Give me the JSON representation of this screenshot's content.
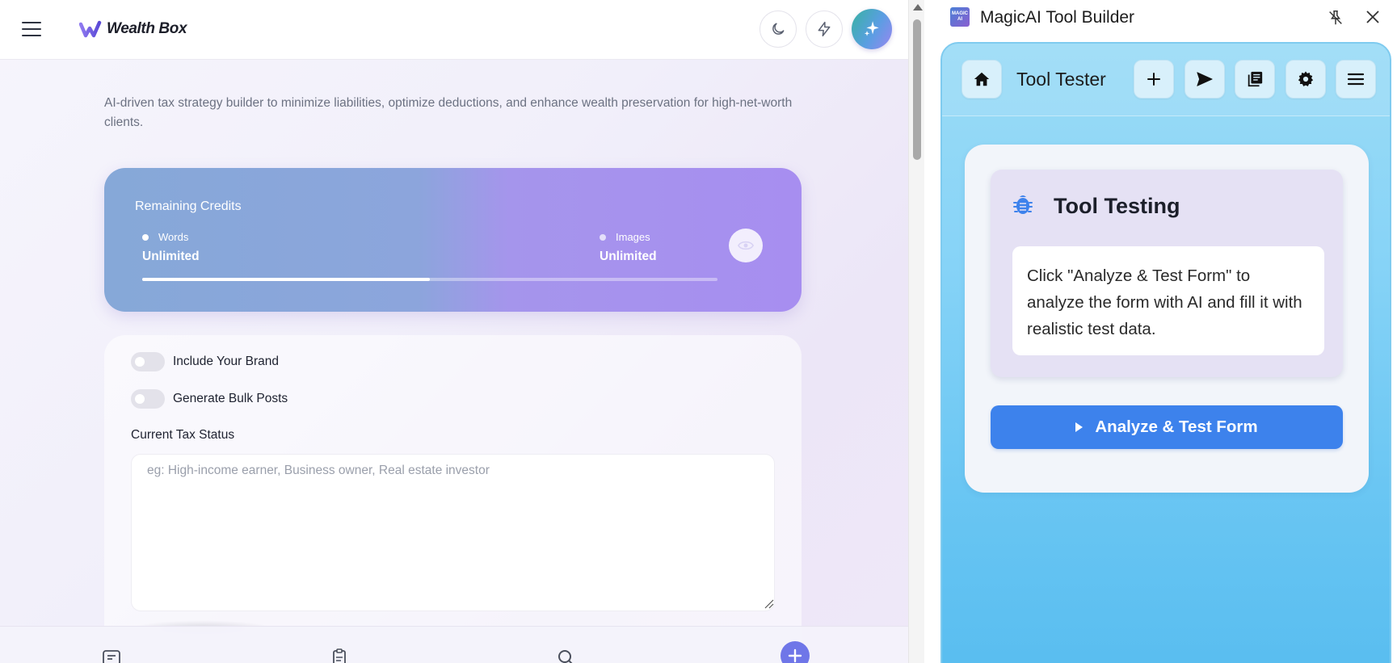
{
  "app": {
    "brand": "Wealth Box",
    "description": "AI-driven tax strategy builder to minimize liabilities, optimize deductions, and enhance wealth preservation for high-net-worth clients.",
    "credits": {
      "title": "Remaining Credits",
      "words_label": "Words",
      "words_value": "Unlimited",
      "images_label": "Images",
      "images_value": "Unlimited",
      "progress": 0.5
    },
    "form": {
      "include_brand_label": "Include Your Brand",
      "include_brand_on": false,
      "bulk_posts_label": "Generate Bulk Posts",
      "bulk_posts_on": false,
      "tax_status_label": "Current Tax Status",
      "tax_status_value": "",
      "tax_status_placeholder": "eg: High-income earner, Business owner, Real estate investor"
    },
    "header_icons": [
      "menu-icon",
      "moon-icon",
      "lightning-icon",
      "sparkle-icon"
    ],
    "bottom_nav_icons": [
      "documents-icon",
      "clipboard-icon",
      "search-icon",
      "plus-icon"
    ]
  },
  "panel": {
    "logo_text": "MAGIC AI",
    "window_title": "MagicAI Tool Builder",
    "toolbar_title": "Tool Tester",
    "toolbar_icons": [
      "home-icon",
      "plus-icon",
      "send-icon",
      "library-icon",
      "gear-icon",
      "menu-icon"
    ],
    "test_title": "Tool Testing",
    "test_message": "Click \"Analyze & Test Form\" to analyze the form with AI and fill it with realistic test data.",
    "analyze_button": "Analyze & Test Form"
  },
  "colors": {
    "accent_blue": "#3d82ec",
    "credits_gradient_start": "#86a8d8",
    "credits_gradient_end": "#a78ef0",
    "panel_background": "#86d3f7"
  }
}
